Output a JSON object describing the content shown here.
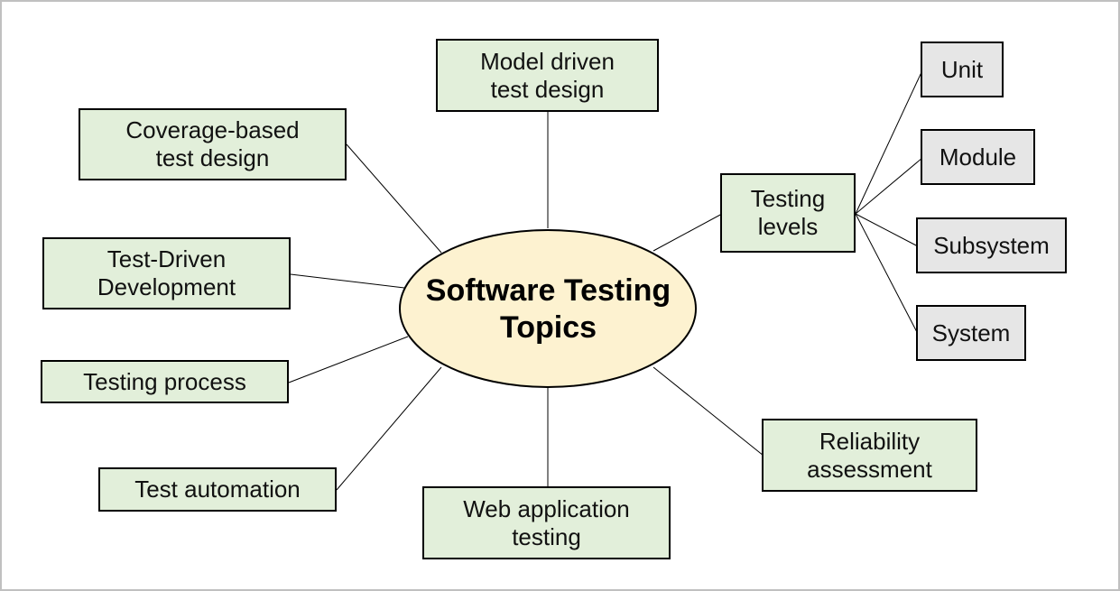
{
  "diagram": {
    "type": "mind-map",
    "colors": {
      "center_fill": "#fdf2d0",
      "topic_fill": "#e2efda",
      "subtopic_fill": "#e6e6e6",
      "border": "#000000",
      "frame_border": "#c0c0c0"
    },
    "center": {
      "label": "Software Testing\nTopics"
    },
    "topics": [
      {
        "id": "model-driven",
        "label": "Model driven\ntest design"
      },
      {
        "id": "coverage",
        "label": "Coverage-based\ntest design"
      },
      {
        "id": "tdd",
        "label": "Test-Driven\nDevelopment"
      },
      {
        "id": "process",
        "label": "Testing process"
      },
      {
        "id": "automation",
        "label": "Test automation"
      },
      {
        "id": "webapp",
        "label": "Web application\ntesting"
      },
      {
        "id": "reliability",
        "label": "Reliability\nassessment"
      },
      {
        "id": "levels",
        "label": "Testing\nlevels"
      }
    ],
    "subtopics": [
      {
        "parent": "levels",
        "id": "unit",
        "label": "Unit"
      },
      {
        "parent": "levels",
        "id": "module",
        "label": "Module"
      },
      {
        "parent": "levels",
        "id": "subsystem",
        "label": "Subsystem"
      },
      {
        "parent": "levels",
        "id": "system",
        "label": "System"
      }
    ]
  }
}
